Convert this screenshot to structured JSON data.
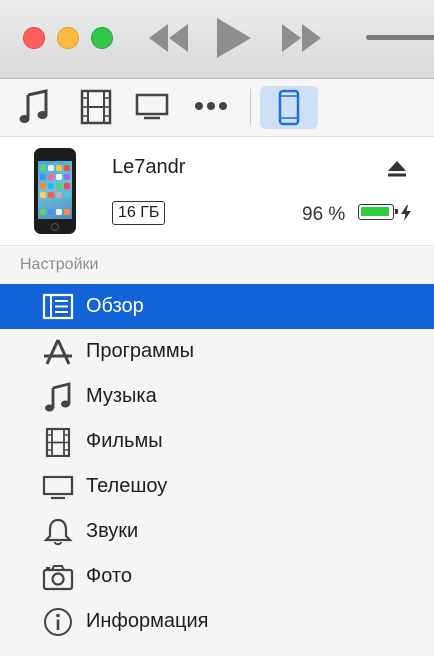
{
  "window": {
    "title_bar": {
      "traffic_lights": [
        "close",
        "minimize",
        "maximize"
      ],
      "transport_icons": [
        "rewind-icon",
        "play-icon",
        "fast-forward-icon"
      ]
    },
    "toolbar": {
      "items": [
        "music-icon",
        "movies-icon",
        "tv-icon",
        "more-icon",
        "device-icon"
      ],
      "selected": "device-icon"
    }
  },
  "device": {
    "name": "Le7andr",
    "capacity": "16 ГБ",
    "battery_percent_text": "96 %",
    "battery_level": 0.96,
    "battery_charging": true
  },
  "sidebar": {
    "section_title": "Настройки",
    "items": [
      {
        "label": "Обзор",
        "icon": "summary-icon",
        "selected": true
      },
      {
        "label": "Программы",
        "icon": "apps-icon",
        "selected": false
      },
      {
        "label": "Музыка",
        "icon": "music-note-icon",
        "selected": false
      },
      {
        "label": "Фильмы",
        "icon": "film-icon",
        "selected": false
      },
      {
        "label": "Телешоу",
        "icon": "tv-shows-icon",
        "selected": false
      },
      {
        "label": "Звуки",
        "icon": "bell-icon",
        "selected": false
      },
      {
        "label": "Фото",
        "icon": "camera-icon",
        "selected": false
      },
      {
        "label": "Информация",
        "icon": "info-icon",
        "selected": false
      }
    ]
  },
  "colors": {
    "selection": "#1363d8",
    "battery_fill": "#2fce3b",
    "toolbar_selected_bg": "#cde0f6",
    "close": "#fc605c",
    "minimize": "#fdbc40",
    "maximize": "#34c84a"
  }
}
